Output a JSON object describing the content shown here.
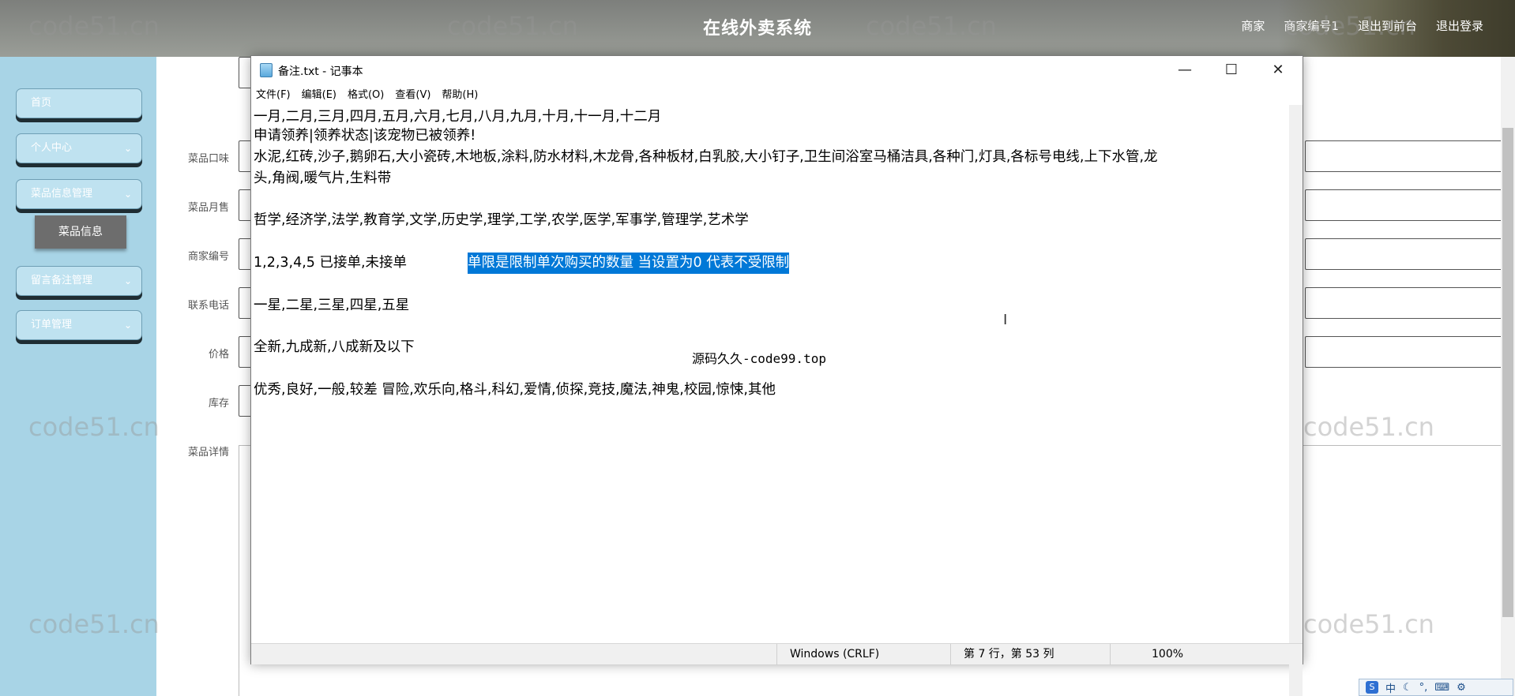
{
  "header": {
    "title": "在线外卖系统",
    "links": [
      "商家",
      "商家编号1",
      "退出到前台",
      "退出登录"
    ]
  },
  "sidebar": {
    "items": [
      {
        "label": "首页"
      },
      {
        "label": "个人中心"
      },
      {
        "label": "菜品信息管理"
      },
      {
        "label": "留言备注管理"
      },
      {
        "label": "订单管理"
      }
    ],
    "sub_item": "菜品信息"
  },
  "form": {
    "labels": [
      "菜品口味",
      "菜品月售",
      "商家编号",
      "联系电话",
      "价格",
      "库存",
      "菜品详情"
    ]
  },
  "watermark": "code51.cn",
  "notepad": {
    "title": "备注.txt - 记事本",
    "menu": [
      "文件(F)",
      "编辑(E)",
      "格式(O)",
      "查看(V)",
      "帮助(H)"
    ],
    "lines": [
      "一月,二月,三月,四月,五月,六月,七月,八月,九月,十月,十一月,十二月",
      "申请领养|领养状态|该宠物已被领养!",
      "水泥,红砖,沙子,鹅卵石,大小瓷砖,木地板,涂料,防水材料,木龙骨,各种板材,白乳胶,大小钉子,卫生间浴室马桶洁具,各种门,灯具,各标号电线,上下水管,龙",
      "头,角阀,暖气片,生料带",
      "哲学,经济学,法学,教育学,文学,历史学,理学,工学,农学,医学,军事学,管理学,艺术学",
      "1,2,3,4,5  已接单,未接单",
      "单限是限制单次购买的数量 当设置为0 代表不受限制",
      "一星,二星,三星,四星,五星",
      "全新,九成新,八成新及以下",
      "优秀,良好,一般,较差   冒险,欢乐向,格斗,科幻,爱情,侦探,竞技,魔法,神鬼,校园,惊悚,其他"
    ],
    "overlay": "源码久久-code99.top",
    "status": {
      "encoding": "Windows (CRLF)",
      "position": "第 7 行，第 53 列",
      "zoom": "100%"
    }
  },
  "ime": {
    "lang": "中"
  }
}
